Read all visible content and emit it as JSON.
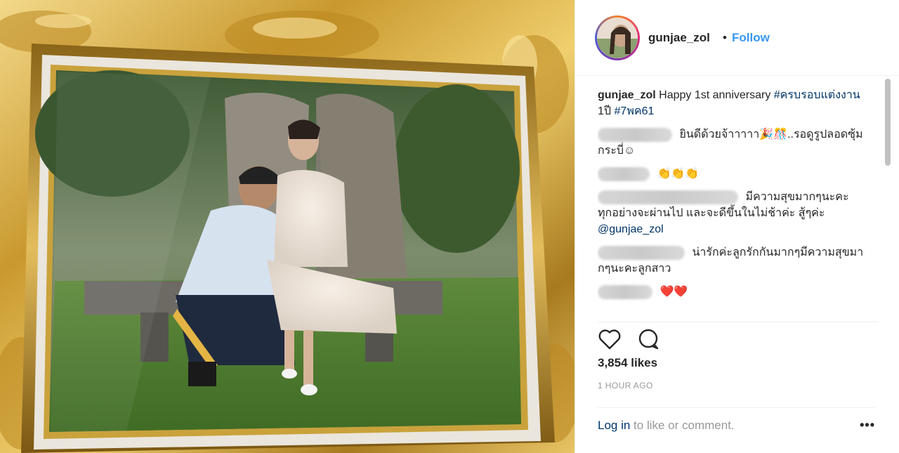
{
  "post": {
    "username": "gunjae_zol",
    "separator": "•",
    "follow_label": "Follow",
    "caption": {
      "username": "gunjae_zol",
      "text": "Happy 1st anniversary",
      "tag1": "#ครบรอบแต่งงาน",
      "mid": "1ปี",
      "tag2": "#7พค61"
    },
    "comments": [
      {
        "text": "ยินดีด้วยจ้าาาาา🎉🎊..รอดูรูปลอดซุ้มกระบี่☺"
      },
      {
        "text": "👏👏👏"
      },
      {
        "text": "มีความสุขมากๆนะคะ ทุกอย่างจะผ่านไป และจะดีขึ้นในไม่ช้าค่ะ สู้ๆค่ะ",
        "mention": "@gunjae_zol"
      },
      {
        "text": "น่ารักค่ะลูกรักกันมากๆมีความสุขมากๆนะคะลูกสาว"
      },
      {
        "text": "❤️❤️"
      }
    ],
    "likes": "3,854 likes",
    "timestamp": "1 HOUR AGO",
    "login": {
      "link": "Log in",
      "rest": " to like or comment."
    },
    "more_label": "•••"
  },
  "icons": [
    "heart-icon",
    "comment-icon"
  ],
  "colors": {
    "accent": "#3897f0",
    "link": "#003569",
    "muted": "#999999",
    "text": "#262626"
  }
}
